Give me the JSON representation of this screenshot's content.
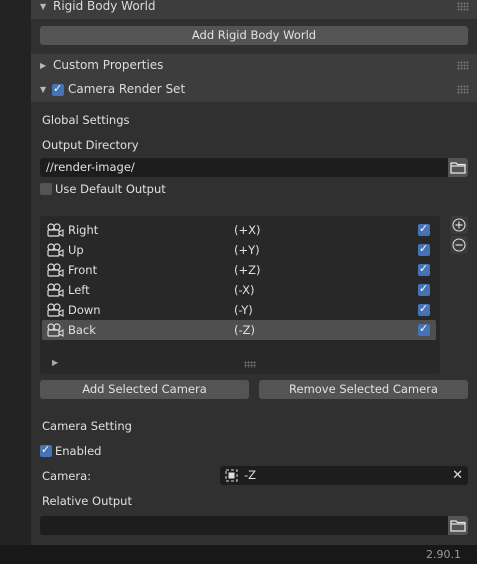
{
  "panels": {
    "rigid_body": {
      "title": "Rigid Body World",
      "add_button": "Add Rigid Body World"
    },
    "custom_props": {
      "title": "Custom Properties"
    },
    "camera_render_set": {
      "title": "Camera Render Set",
      "enabled": true
    }
  },
  "global_settings": {
    "heading": "Global Settings",
    "output_dir_label": "Output Directory",
    "output_dir_value": "//render-image/",
    "use_default_output_label": "Use Default Output",
    "use_default_output": false
  },
  "camera_list": [
    {
      "name": "Right",
      "axis": "(+X)",
      "enabled": true,
      "selected": false
    },
    {
      "name": "Up",
      "axis": "(+Y)",
      "enabled": true,
      "selected": false
    },
    {
      "name": "Front",
      "axis": "(+Z)",
      "enabled": true,
      "selected": false
    },
    {
      "name": "Left",
      "axis": "(-X)",
      "enabled": true,
      "selected": false
    },
    {
      "name": "Down",
      "axis": "(-Y)",
      "enabled": true,
      "selected": false
    },
    {
      "name": "Back",
      "axis": "(-Z)",
      "enabled": true,
      "selected": true
    }
  ],
  "list_buttons": {
    "add": "+",
    "remove": "−"
  },
  "actions": {
    "add_selected": "Add Selected Camera",
    "remove_selected": "Remove Selected Camera"
  },
  "camera_setting": {
    "heading": "Camera Setting",
    "enabled_label": "Enabled",
    "enabled": true,
    "camera_label": "Camera:",
    "camera_value": "-Z",
    "relative_output_label": "Relative Output",
    "relative_output_value": ""
  },
  "footer": {
    "version": "2.90.1"
  },
  "colors": {
    "accent": "#4772b3",
    "panel_bg": "#303030",
    "header_bg": "#3d3d3d",
    "button_bg": "#545454"
  }
}
